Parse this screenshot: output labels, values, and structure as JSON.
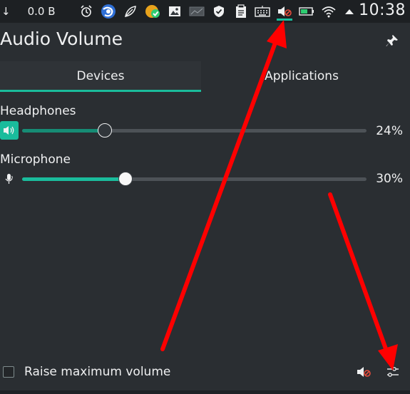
{
  "panel": {
    "net_arrow": "↓",
    "net_rate": "0.0 B",
    "clock": "10:38",
    "icons": [
      "alarm-clock-icon",
      "browser-globe-icon",
      "leaf-app-icon",
      "update-check-icon",
      "image-viewer-icon",
      "display-icon",
      "shield-icon",
      "clipboard-icon",
      "keyboard-icon",
      "volume-muted-icon",
      "battery-icon",
      "wifi-icon",
      "expand-tray-arrow-icon"
    ]
  },
  "popup": {
    "title": "Audio Volume",
    "pin_icon": "pin-icon"
  },
  "tabs": [
    {
      "label": "Devices",
      "active": true
    },
    {
      "label": "Applications",
      "active": false
    }
  ],
  "devices": [
    {
      "label": "Headphones",
      "icon": "speaker-icon",
      "value_percent": 24,
      "percent_label": "24%"
    },
    {
      "label": "Microphone",
      "icon": "microphone-icon",
      "value_percent": 30,
      "percent_label": "30%"
    }
  ],
  "footer": {
    "raise_label": "Raise maximum volume",
    "raise_checked": false,
    "mute_icon": "volume-muted-icon",
    "config_icon": "configure-icon"
  },
  "colors": {
    "accent": "#1abc9c",
    "background": "#2a2e32",
    "panel": "#1d2023",
    "annotation_arrow": "#ff0000"
  }
}
